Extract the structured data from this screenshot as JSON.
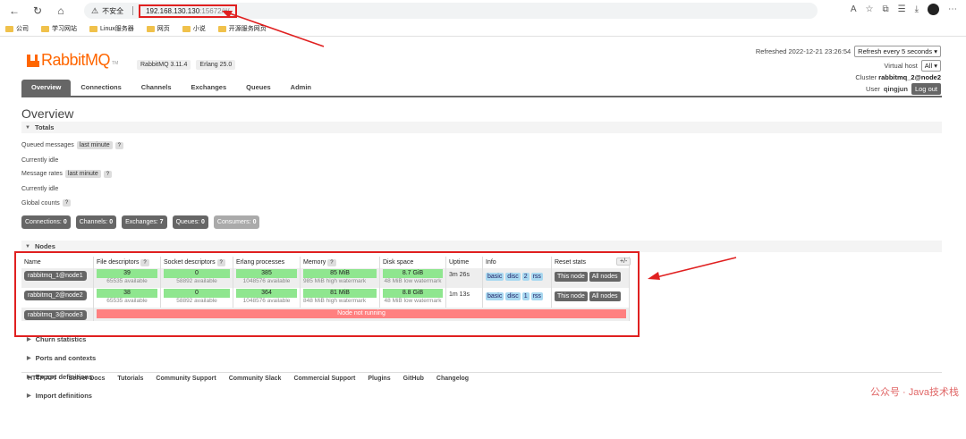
{
  "browser": {
    "insecure_label": "不安全",
    "url_host": "192.168.130.130",
    "url_path": ":15672/#/",
    "bookmarks": [
      "公司",
      "学习网站",
      "Linux服务器",
      "网页",
      "小说",
      "开源服务网页"
    ]
  },
  "header": {
    "logo_text": "RabbitMQ",
    "logo_tm": "TM",
    "version_rabbit": "RabbitMQ 3.11.4",
    "version_erlang": "Erlang 25.0",
    "refreshed_label": "Refreshed 2022-12-21 23:26:54",
    "refresh_select": "Refresh every 5 seconds",
    "vhost_label": "Virtual host",
    "vhost_select": "All",
    "cluster_label": "Cluster",
    "cluster_value": "rabbitmq_2@node2",
    "user_label": "User",
    "user_value": "qingjun",
    "logout_label": "Log out"
  },
  "tabs": [
    "Overview",
    "Connections",
    "Channels",
    "Exchanges",
    "Queues",
    "Admin"
  ],
  "page_title": "Overview",
  "totals": {
    "heading": "Totals",
    "queued_label": "Queued messages",
    "queued_pill": "last minute",
    "help": "?",
    "idle1": "Currently idle",
    "rates_label": "Message rates",
    "rates_pill": "last minute",
    "idle2": "Currently idle",
    "global_label": "Global counts",
    "counts": [
      {
        "label": "Connections:",
        "value": "0"
      },
      {
        "label": "Channels:",
        "value": "0"
      },
      {
        "label": "Exchanges:",
        "value": "7"
      },
      {
        "label": "Queues:",
        "value": "0"
      },
      {
        "label": "Consumers:",
        "value": "0"
      }
    ]
  },
  "nodes": {
    "heading": "Nodes",
    "columns": [
      "Name",
      "File descriptors",
      "Socket descriptors",
      "Erlang processes",
      "Memory",
      "Disk space",
      "Uptime",
      "Info",
      "Reset stats"
    ],
    "plusminus": "+/-",
    "rows": [
      {
        "name": "rabbitmq_1@node1",
        "fd": "39",
        "fd_sub": "65535 available",
        "sd": "0",
        "sd_sub": "58892 available",
        "ep": "385",
        "ep_sub": "1048576 available",
        "mem": "85 MiB",
        "mem_sub": "985 MiB high watermark",
        "disk": "8.7 GiB",
        "disk_sub": "48 MiB low watermark",
        "uptime": "3m 26s",
        "info": [
          "basic",
          "disc",
          "2",
          "rss"
        ],
        "reset": [
          "This node",
          "All nodes"
        ]
      },
      {
        "name": "rabbitmq_2@node2",
        "fd": "38",
        "fd_sub": "65535 available",
        "sd": "0",
        "sd_sub": "58892 available",
        "ep": "364",
        "ep_sub": "1048576 available",
        "mem": "81 MiB",
        "mem_sub": "848 MiB high watermark",
        "disk": "8.8 GiB",
        "disk_sub": "48 MiB low watermark",
        "uptime": "1m 13s",
        "info": [
          "basic",
          "disc",
          "1",
          "rss"
        ],
        "reset": [
          "This node",
          "All nodes"
        ]
      },
      {
        "name": "rabbitmq_3@node3",
        "status": "Node not running"
      }
    ]
  },
  "collapsed_sections": [
    "Churn statistics",
    "Ports and contexts",
    "Export definitions",
    "Import definitions"
  ],
  "footer_links": [
    "HTTP API",
    "Server Docs",
    "Tutorials",
    "Community Support",
    "Community Slack",
    "Commercial Support",
    "Plugins",
    "GitHub",
    "Changelog"
  ],
  "watermark": "公众号 · Java技术栈",
  "colors": {
    "brand": "#ff6600",
    "annotation_red": "#e02020",
    "ok_green": "#8fe68f",
    "error_red": "#ff8080"
  }
}
